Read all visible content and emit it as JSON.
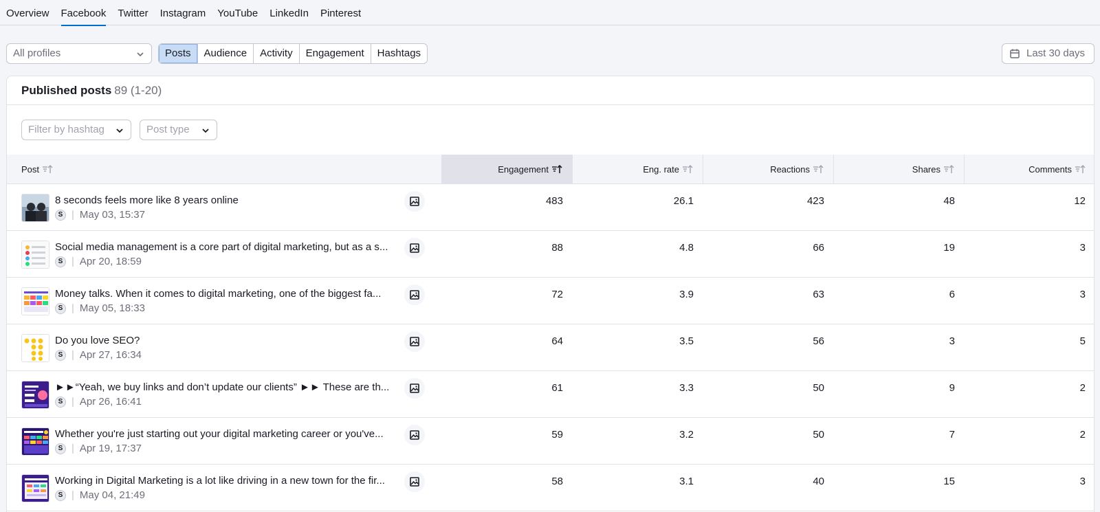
{
  "nav": {
    "tabs": [
      {
        "label": "Overview"
      },
      {
        "label": "Facebook",
        "active": true
      },
      {
        "label": "Twitter"
      },
      {
        "label": "Instagram"
      },
      {
        "label": "YouTube"
      },
      {
        "label": "LinkedIn"
      },
      {
        "label": "Pinterest"
      }
    ]
  },
  "controls": {
    "profile_select": "All profiles",
    "segments": [
      {
        "label": "Posts",
        "active": true
      },
      {
        "label": "Audience"
      },
      {
        "label": "Activity"
      },
      {
        "label": "Engagement"
      },
      {
        "label": "Hashtags"
      }
    ],
    "date_range": "Last 30 days"
  },
  "card": {
    "title": "Published posts",
    "count": "89 (1-20)",
    "filter_hashtag": "Filter by hashtag",
    "filter_post_type": "Post type"
  },
  "table": {
    "columns": {
      "post": "Post",
      "engagement": "Engagement",
      "eng_rate": "Eng. rate",
      "reactions": "Reactions",
      "shares": "Shares",
      "comments": "Comments"
    },
    "rows": [
      {
        "text": "8 seconds feels more like 8 years online",
        "badge": "S",
        "date": "May 03, 15:37",
        "engagement": "483",
        "eng_rate": "26.1",
        "reactions": "423",
        "shares": "48",
        "comments": "12"
      },
      {
        "text": "Social media management is a core part of digital marketing, but as a s...",
        "badge": "S",
        "date": "Apr 20, 18:59",
        "engagement": "88",
        "eng_rate": "4.8",
        "reactions": "66",
        "shares": "19",
        "comments": "3"
      },
      {
        "text": "Money talks. When it comes to digital marketing, one of the biggest fa...",
        "badge": "S",
        "date": "May 05, 18:33",
        "engagement": "72",
        "eng_rate": "3.9",
        "reactions": "63",
        "shares": "6",
        "comments": "3"
      },
      {
        "text": "Do you love SEO?",
        "badge": "S",
        "date": "Apr 27, 16:34",
        "engagement": "64",
        "eng_rate": "3.5",
        "reactions": "56",
        "shares": "3",
        "comments": "5"
      },
      {
        "text": "►►“Yeah, we buy links and don’t update our clients” ►► These are th...",
        "badge": "S",
        "date": "Apr 26, 16:41",
        "engagement": "61",
        "eng_rate": "3.3",
        "reactions": "50",
        "shares": "9",
        "comments": "2"
      },
      {
        "text": "Whether you're just starting out your digital marketing career or you've...",
        "badge": "S",
        "date": "Apr 19, 17:37",
        "engagement": "59",
        "eng_rate": "3.2",
        "reactions": "50",
        "shares": "7",
        "comments": "2"
      },
      {
        "text": "Working in Digital Marketing is a lot like driving in a new town for the fir...",
        "badge": "S",
        "date": "May 04, 21:49",
        "engagement": "58",
        "eng_rate": "3.1",
        "reactions": "40",
        "shares": "15",
        "comments": "3"
      }
    ]
  },
  "colors": {
    "accent": "#006dca",
    "active_segment": "#c8dcf6",
    "border": "#c4c7cf"
  }
}
